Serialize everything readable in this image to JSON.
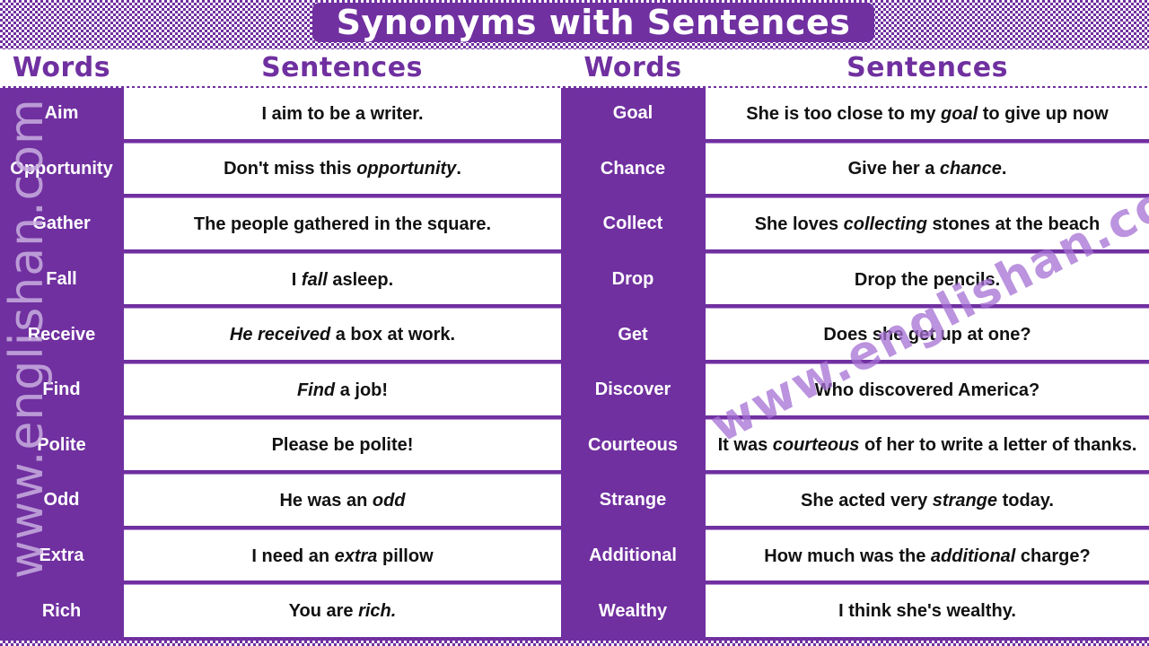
{
  "title": "Synonyms with Sentences",
  "headers": {
    "left_words": "Words",
    "left_sentences": "Sentences",
    "right_words": "Words",
    "right_sentences": "Sentences"
  },
  "colors": {
    "accent": "#7030a0",
    "separator_light": "#b68fd3",
    "text": "#111111",
    "watermark": "#a56fd3"
  },
  "rows": [
    {
      "word": "Aim",
      "sentence": [
        {
          "t": "I aim to be a writer."
        }
      ],
      "synonym": "Goal",
      "synonym_sentence": [
        {
          "t": "She is too close to my "
        },
        {
          "t": "goal",
          "i": true
        },
        {
          "t": " to give up now"
        }
      ]
    },
    {
      "word": "Opportunity",
      "sentence": [
        {
          "t": "Don't miss this "
        },
        {
          "t": "opportunity",
          "i": true
        },
        {
          "t": "."
        }
      ],
      "synonym": "Chance",
      "synonym_sentence": [
        {
          "t": "Give her a "
        },
        {
          "t": "chance",
          "i": true
        },
        {
          "t": "."
        }
      ]
    },
    {
      "word": "Gather",
      "sentence": [
        {
          "t": "The people gathered in the square."
        }
      ],
      "synonym": "Collect",
      "synonym_sentence": [
        {
          "t": "She loves "
        },
        {
          "t": "collecting",
          "i": true
        },
        {
          "t": " stones at the beach"
        }
      ]
    },
    {
      "word": "Fall",
      "sentence": [
        {
          "t": "I "
        },
        {
          "t": "fall",
          "i": true
        },
        {
          "t": " asleep."
        }
      ],
      "synonym": "Drop",
      "synonym_sentence": [
        {
          "t": "Drop the pencils."
        }
      ]
    },
    {
      "word": "Receive",
      "sentence": [
        {
          "t": "He received",
          "i": true
        },
        {
          "t": " a box at work."
        }
      ],
      "synonym": "Get",
      "synonym_sentence": [
        {
          "t": "Does she get up at one?"
        }
      ]
    },
    {
      "word": "Find",
      "sentence": [
        {
          "t": "Find",
          "i": true
        },
        {
          "t": " a job!"
        }
      ],
      "synonym": "Discover",
      "synonym_sentence": [
        {
          "t": "Who discovered America?"
        }
      ]
    },
    {
      "word": "Polite",
      "sentence": [
        {
          "t": "Please be polite!"
        }
      ],
      "synonym": "Courteous",
      "synonym_sentence": [
        {
          "t": "It was "
        },
        {
          "t": "courteous",
          "i": true
        },
        {
          "t": " of her to write a letter of thanks."
        }
      ]
    },
    {
      "word": "Odd",
      "sentence": [
        {
          "t": "He was an "
        },
        {
          "t": "odd",
          "i": true
        }
      ],
      "synonym": "Strange",
      "synonym_sentence": [
        {
          "t": "She acted very "
        },
        {
          "t": "strange",
          "i": true
        },
        {
          "t": " today."
        }
      ]
    },
    {
      "word": "Extra",
      "sentence": [
        {
          "t": "I need an "
        },
        {
          "t": "extra",
          "i": true
        },
        {
          "t": " pillow"
        }
      ],
      "synonym": "Additional",
      "synonym_sentence": [
        {
          "t": "How much was the "
        },
        {
          "t": "additional",
          "i": true
        },
        {
          "t": " charge?"
        }
      ]
    },
    {
      "word": "Rich",
      "sentence": [
        {
          "t": "You are "
        },
        {
          "t": "rich.",
          "i": true
        }
      ],
      "synonym": "Wealthy",
      "synonym_sentence": [
        {
          "t": "I think she's wealthy."
        }
      ]
    }
  ],
  "watermarks": {
    "vertical": "www.englishan.com",
    "diagonal": "www.englishan.com"
  }
}
